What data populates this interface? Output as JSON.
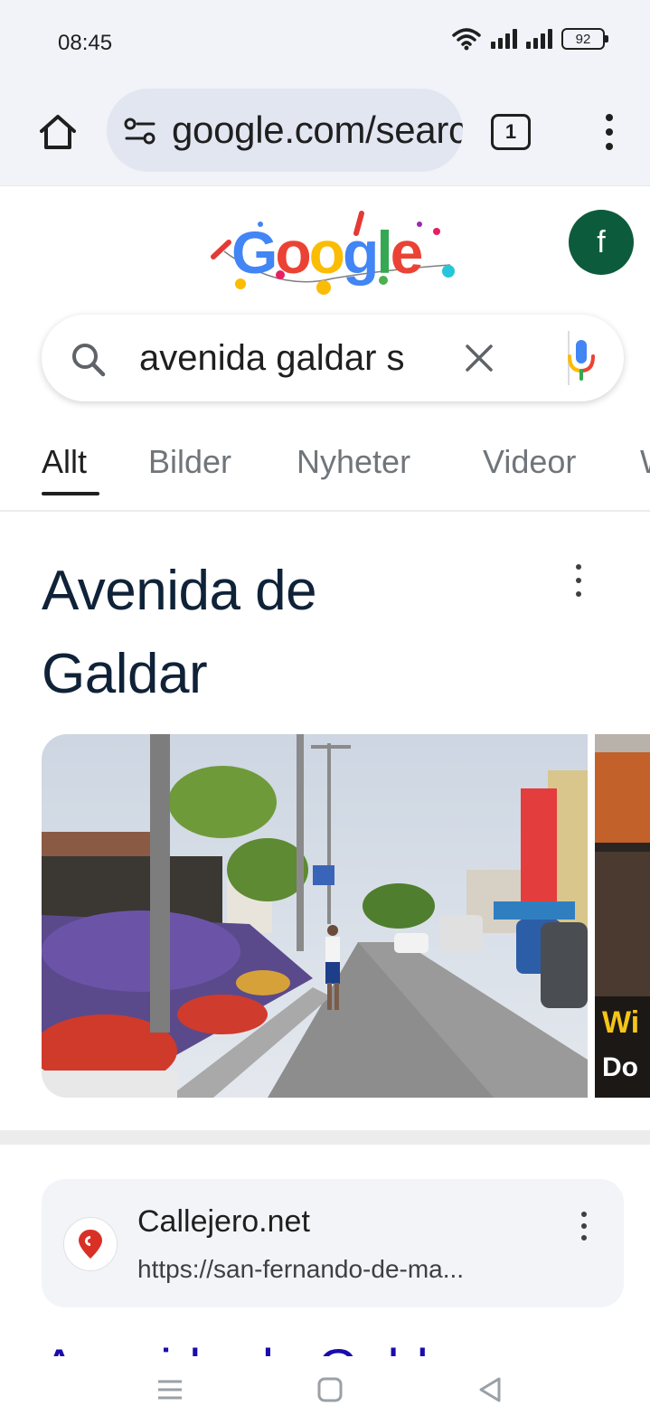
{
  "status_bar": {
    "time": "08:45",
    "battery": "92"
  },
  "browser": {
    "url": "google.com/search",
    "tab_count": "1"
  },
  "account": {
    "avatar_letter": "f"
  },
  "search": {
    "query": "avenida galdar s"
  },
  "tabs": [
    {
      "label": "Allt",
      "active": true
    },
    {
      "label": "Bilder",
      "active": false
    },
    {
      "label": "Nyheter",
      "active": false
    },
    {
      "label": "Videor",
      "active": false
    },
    {
      "label": "W",
      "active": false
    }
  ],
  "knowledge_panel": {
    "title_line1": "Avenida de",
    "title_line2": "Galdar",
    "next_photo_text": [
      "Wi",
      "Do"
    ]
  },
  "result": {
    "site_name": "Callejero.net",
    "url": "https://san-fernando-de-ma...",
    "title_partial": "Avenida de Galdar"
  },
  "colors": {
    "accent_dark": "#0f2238",
    "avatar_bg": "#0d5b3d",
    "site_icon_red": "#d93025"
  },
  "icons": [
    "home-icon",
    "tune-icon",
    "tab-switcher-icon",
    "more-vert-icon",
    "search-icon",
    "close-icon",
    "mic-icon",
    "location-pin-icon",
    "recents-icon",
    "home-nav-icon",
    "back-icon"
  ]
}
